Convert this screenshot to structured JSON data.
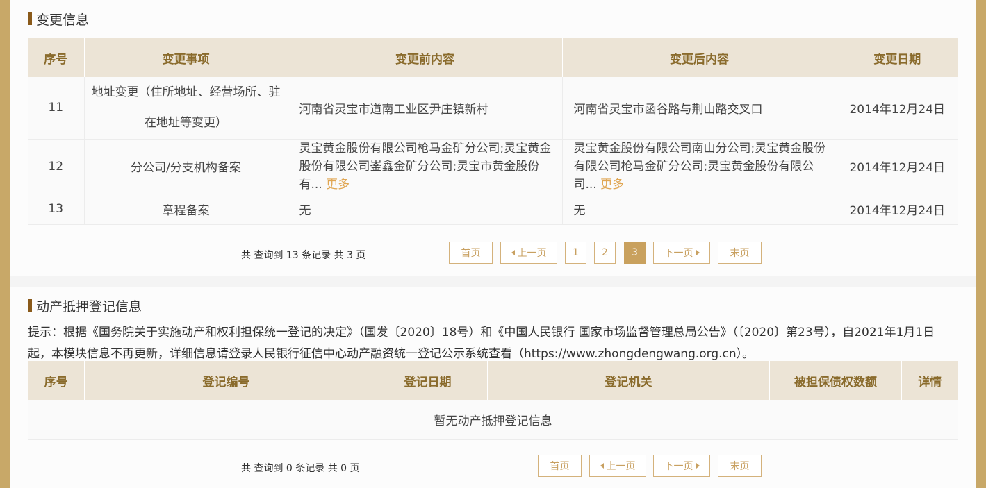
{
  "change_section": {
    "title": "变更信息",
    "headers": [
      "序号",
      "变更事项",
      "变更前内容",
      "变更后内容",
      "变更日期"
    ],
    "rows": [
      {
        "no": "11",
        "item": "地址变更（住所地址、经营场所、驻在地址等变更）",
        "before": "河南省灵宝市道南工业区尹庄镇新村",
        "after": "河南省灵宝市函谷路与荆山路交叉口",
        "date": "2014年12月24日"
      },
      {
        "no": "12",
        "item": "分公司/分支机构备案",
        "before": "灵宝黄金股份有限公司枪马金矿分公司;灵宝黄金股份有限公司崟鑫金矿分公司;灵宝市黄金股份有...",
        "after": "灵宝黄金股份有限公司南山分公司;灵宝黄金股份有限公司枪马金矿分公司;灵宝黄金股份有限公司...",
        "date": "2014年12月24日"
      },
      {
        "no": "13",
        "item": "章程备案",
        "before": "无",
        "after": "无",
        "date": "2014年12月24日"
      }
    ],
    "more_label": "更多",
    "pager": {
      "total_text": "共 查询到 13 条记录 共 3 页",
      "first": "首页",
      "prev": "上一页",
      "pages": [
        "1",
        "2",
        "3"
      ],
      "current": "3",
      "next": "下一页",
      "last": "末页"
    }
  },
  "pledge_section": {
    "title": "动产抵押登记信息",
    "notice": "提示：根据《国务院关于实施动产和权利担保统一登记的决定》（国发〔2020〕18号）和《中国人民银行 国家市场监督管理总局公告》（〔2020〕第23号），自2021年1月1日起，本模块信息不再更新，详细信息请登录人民银行征信中心动产融资统一登记公示系统查看（https://www.zhongdengwang.org.cn）。",
    "headers": [
      "序号",
      "登记编号",
      "登记日期",
      "登记机关",
      "被担保债权数额",
      "详情"
    ],
    "empty_text": "暂无动产抵押登记信息",
    "pager": {
      "total_text": "共 查询到 0 条记录 共 0 页",
      "first": "首页",
      "prev": "上一页",
      "next": "下一页",
      "last": "末页"
    }
  },
  "colors": {
    "accent": "#c8a868",
    "header_bg": "#ece4d6",
    "header_text": "#8a6b2c",
    "more_link": "#e0a652"
  }
}
